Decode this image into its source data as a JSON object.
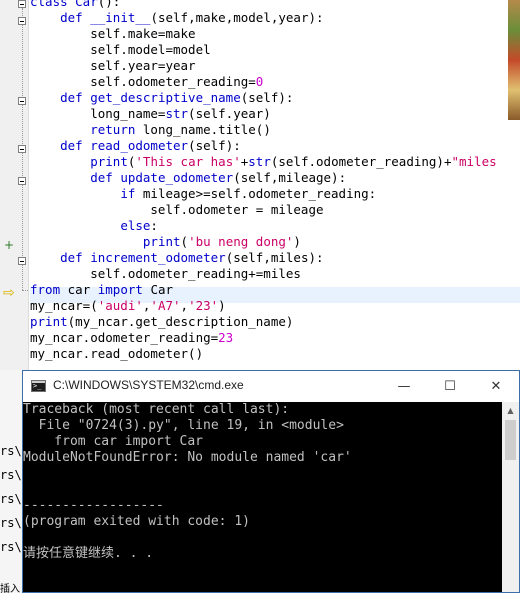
{
  "editor": {
    "lines": [
      [
        {
          "t": "class ",
          "c": "kw"
        },
        {
          "t": "Car",
          "c": "fn"
        },
        {
          "t": "():",
          "c": ""
        }
      ],
      [
        {
          "t": "    ",
          "c": ""
        },
        {
          "t": "def ",
          "c": "kw"
        },
        {
          "t": "__init__",
          "c": "fn"
        },
        {
          "t": "(self,make,model,year):",
          "c": ""
        }
      ],
      [
        {
          "t": "        self.make=make",
          "c": ""
        }
      ],
      [
        {
          "t": "        self.model=model",
          "c": ""
        }
      ],
      [
        {
          "t": "        self.year=year",
          "c": ""
        }
      ],
      [
        {
          "t": "        self.odometer_reading=",
          "c": ""
        },
        {
          "t": "0",
          "c": "num"
        }
      ],
      [
        {
          "t": "    ",
          "c": ""
        },
        {
          "t": "def ",
          "c": "kw"
        },
        {
          "t": "get_descriptive_name",
          "c": "fn"
        },
        {
          "t": "(self):",
          "c": ""
        }
      ],
      [
        {
          "t": "        long_name=",
          "c": ""
        },
        {
          "t": "str",
          "c": "kw"
        },
        {
          "t": "(self.year)",
          "c": ""
        }
      ],
      [
        {
          "t": "        ",
          "c": ""
        },
        {
          "t": "return ",
          "c": "kw"
        },
        {
          "t": "long_name.title()",
          "c": ""
        }
      ],
      [
        {
          "t": "    ",
          "c": ""
        },
        {
          "t": "def ",
          "c": "kw"
        },
        {
          "t": "read_odometer",
          "c": "fn"
        },
        {
          "t": "(self):",
          "c": ""
        }
      ],
      [
        {
          "t": "        ",
          "c": ""
        },
        {
          "t": "print",
          "c": "kw"
        },
        {
          "t": "(",
          "c": ""
        },
        {
          "t": "'This car has'",
          "c": "str"
        },
        {
          "t": "+",
          "c": ""
        },
        {
          "t": "str",
          "c": "kw"
        },
        {
          "t": "(self.odometer_reading)+",
          "c": ""
        },
        {
          "t": "\"miles",
          "c": "str"
        }
      ],
      [
        {
          "t": "        ",
          "c": ""
        },
        {
          "t": "def ",
          "c": "kw"
        },
        {
          "t": "update_odometer",
          "c": "fn"
        },
        {
          "t": "(self,mileage):",
          "c": ""
        }
      ],
      [
        {
          "t": "            ",
          "c": ""
        },
        {
          "t": "if ",
          "c": "kw"
        },
        {
          "t": "mileage>=self.odometer_reading:",
          "c": ""
        }
      ],
      [
        {
          "t": "                self.odometer = mileage",
          "c": ""
        }
      ],
      [
        {
          "t": "            ",
          "c": ""
        },
        {
          "t": "else",
          "c": "kw"
        },
        {
          "t": ":",
          "c": ""
        }
      ],
      [
        {
          "t": "               ",
          "c": ""
        },
        {
          "t": "print",
          "c": "kw"
        },
        {
          "t": "(",
          "c": ""
        },
        {
          "t": "'bu neng dong'",
          "c": "str"
        },
        {
          "t": ")",
          "c": ""
        }
      ],
      [
        {
          "t": "    ",
          "c": ""
        },
        {
          "t": "def ",
          "c": "kw"
        },
        {
          "t": "increment_odometer",
          "c": "fn"
        },
        {
          "t": "(self,miles):",
          "c": ""
        }
      ],
      [
        {
          "t": "        self.odometer_reading+=miles",
          "c": ""
        }
      ],
      [
        {
          "t": "from ",
          "c": "kw"
        },
        {
          "t": "car ",
          "c": ""
        },
        {
          "t": "import ",
          "c": "kw"
        },
        {
          "t": "Car",
          "c": ""
        }
      ],
      [
        {
          "t": "my_ncar=(",
          "c": ""
        },
        {
          "t": "'audi'",
          "c": "str"
        },
        {
          "t": ",",
          "c": ""
        },
        {
          "t": "'A7'",
          "c": "str"
        },
        {
          "t": ",",
          "c": ""
        },
        {
          "t": "'23'",
          "c": "str"
        },
        {
          "t": ")",
          "c": ""
        }
      ],
      [
        {
          "t": "print",
          "c": "kw"
        },
        {
          "t": "(my_ncar.get_description_name)",
          "c": ""
        }
      ],
      [
        {
          "t": "my_ncar.odometer_reading=",
          "c": ""
        },
        {
          "t": "23",
          "c": "num"
        }
      ],
      [
        {
          "t": "my_ncar.read_odometer()",
          "c": ""
        }
      ]
    ],
    "bookmark_plus": "+",
    "bookmark_arrow": "⇨"
  },
  "side_strip": {
    "items": [
      "rs\\",
      "rs\\",
      "rs\\",
      "rs\\",
      "rs\\",
      "插入"
    ]
  },
  "cmd": {
    "title": "C:\\WINDOWS\\SYSTEM32\\cmd.exe",
    "minimize_glyph": "—",
    "maximize_glyph": "☐",
    "close_glyph": "✕",
    "lines": [
      "Traceback (most recent call last):",
      "  File \"0724(3).py\", line 19, in <module>",
      "    from car import Car",
      "ModuleNotFoundError: No module named 'car'",
      "",
      "",
      "------------------",
      "(program exited with code: 1)",
      "",
      "请按任意键继续. . ."
    ],
    "colors": {
      "background": "#000000",
      "text": "#c0c0c0",
      "border": "#3c6ea8"
    }
  },
  "colors": {
    "keyword": "#0000cc",
    "number": "#cc00cc",
    "string": "#cc0066"
  }
}
